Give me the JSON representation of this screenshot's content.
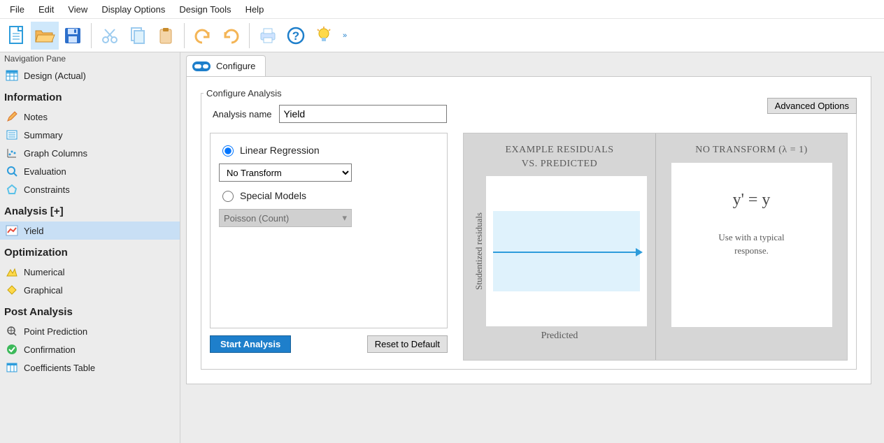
{
  "menubar": {
    "items": [
      "File",
      "Edit",
      "View",
      "Display Options",
      "Design Tools",
      "Help"
    ]
  },
  "nav": {
    "title": "Navigation Pane",
    "design": "Design (Actual)",
    "sections": {
      "information": {
        "label": "Information",
        "items": [
          "Notes",
          "Summary",
          "Graph Columns",
          "Evaluation",
          "Constraints"
        ]
      },
      "analysis": {
        "label": "Analysis [+]",
        "items": [
          "Yield"
        ],
        "selected": "Yield"
      },
      "optimization": {
        "label": "Optimization",
        "items": [
          "Numerical",
          "Graphical"
        ]
      },
      "post": {
        "label": "Post Analysis",
        "items": [
          "Point Prediction",
          "Confirmation",
          "Coefficients Table"
        ]
      }
    }
  },
  "tab": {
    "label": "Configure"
  },
  "configure": {
    "legend": "Configure Analysis",
    "name_label": "Analysis name",
    "name_value": "Yield",
    "advanced": "Advanced Options",
    "radio_linear": "Linear Regression",
    "transform_value": "No Transform",
    "radio_special": "Special Models",
    "special_value": "Poisson (Count)",
    "start": "Start Analysis",
    "reset": "Reset to Default"
  },
  "cards": {
    "residuals": {
      "title_l1": "EXAMPLE RESIDUALS",
      "title_l2": "VS. PREDICTED",
      "ylab": "Studentized residuals",
      "xlab": "Predicted"
    },
    "transform": {
      "title": "NO TRANSFORM (λ = 1)",
      "formula": "y' = y",
      "desc_l1": "Use with a typical",
      "desc_l2": "response."
    }
  }
}
